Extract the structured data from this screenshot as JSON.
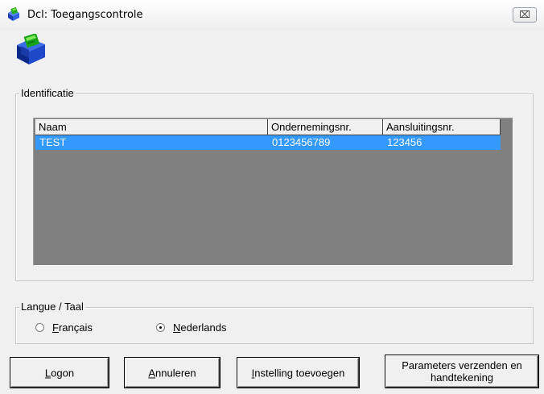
{
  "window": {
    "title": "Dcl: Toegangscontrole",
    "close_symbol": "⌧",
    "title_icon": "app-logo-icon",
    "app_icon": "app-logo-icon"
  },
  "identification": {
    "legend": "Identificatie",
    "columns": [
      "Naam",
      "Ondernemingsnr.",
      "Aansluitingsnr."
    ],
    "rows": [
      {
        "naam": "TEST",
        "ondernemingsnr": "0123456789",
        "aansluitingsnr": "123456",
        "selected": true
      }
    ]
  },
  "language": {
    "legend": "Langue / Taal",
    "options": [
      {
        "accel": "F",
        "rest": "rançais",
        "selected": false
      },
      {
        "accel": "N",
        "rest": "ederlands",
        "selected": true
      }
    ]
  },
  "buttons": {
    "logon": {
      "accel": "L",
      "rest": "ogon"
    },
    "cancel": {
      "accel": "A",
      "rest": "nnuleren"
    },
    "add_setting": {
      "accel": "I",
      "rest": "nstelling toevoegen"
    },
    "send_params_line1": "Parameters verzenden en",
    "send_params_line2": "handtekening"
  },
  "colors": {
    "selection": "#3399ff",
    "list_background": "#808080",
    "window_background": "#f0f0f0"
  }
}
